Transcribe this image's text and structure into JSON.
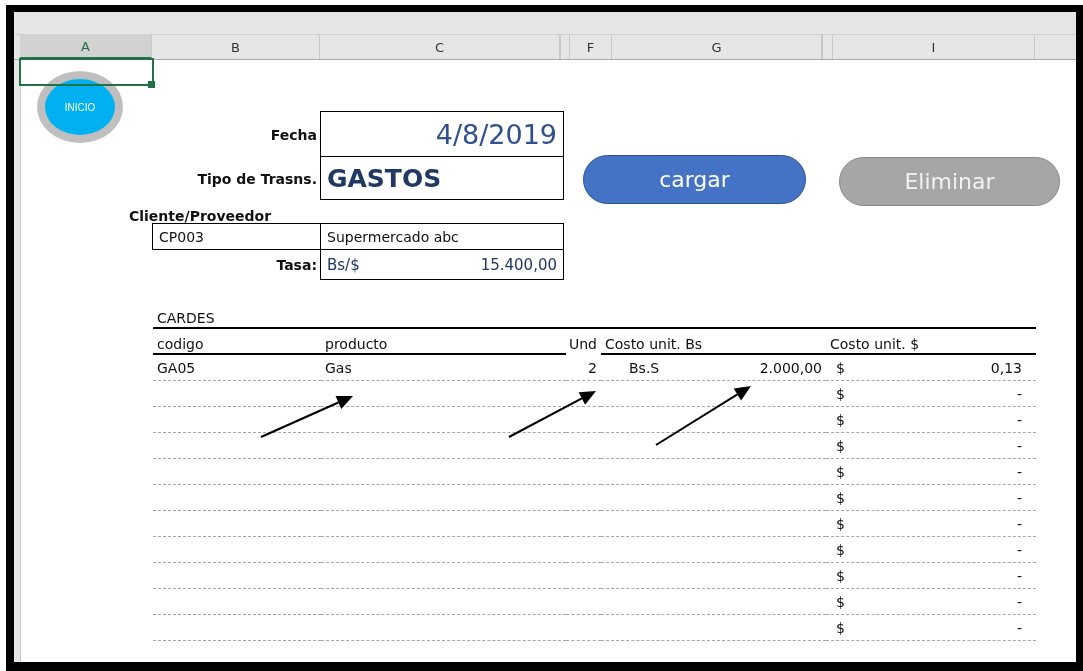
{
  "column_headers": [
    {
      "label": "A",
      "selected": true
    },
    {
      "label": "B",
      "selected": false
    },
    {
      "label": "C",
      "selected": false
    },
    {
      "label": "F",
      "selected": false
    },
    {
      "label": "G",
      "selected": false
    },
    {
      "label": "I",
      "selected": false
    }
  ],
  "inicio_button": {
    "label": "INICIO"
  },
  "form": {
    "fecha": {
      "label": "Fecha",
      "value": "4/8/2019"
    },
    "tipo": {
      "label": "Tipo de Trasns.",
      "value": "GASTOS"
    },
    "cliente": {
      "label": "Cliente/Proveedor",
      "code": "CP003",
      "name": "Supermercado abc"
    },
    "tasa": {
      "label": "Tasa:",
      "unit": "Bs/$",
      "value": "15.400,00"
    }
  },
  "buttons": [
    {
      "label": "cargar",
      "kind": "primary"
    },
    {
      "label": "Eliminar",
      "kind": "secondary"
    }
  ],
  "table": {
    "title": "CARDES",
    "columns": [
      "codigo",
      "producto",
      "Und",
      "Costo unit. Bs",
      "Costo unit. $"
    ],
    "rows": [
      {
        "codigo": "GA05",
        "producto": "Gas",
        "und": "2",
        "bs_currency": "Bs.S",
        "bs_value": "2.000,00",
        "usd_currency": "$",
        "usd_value": "0,13"
      },
      {
        "usd_currency": "$",
        "usd_value": "-"
      },
      {
        "usd_currency": "$",
        "usd_value": "-"
      },
      {
        "usd_currency": "$",
        "usd_value": "-"
      },
      {
        "usd_currency": "$",
        "usd_value": "-"
      },
      {
        "usd_currency": "$",
        "usd_value": "-"
      },
      {
        "usd_currency": "$",
        "usd_value": "-"
      },
      {
        "usd_currency": "$",
        "usd_value": "-"
      },
      {
        "usd_currency": "$",
        "usd_value": "-"
      },
      {
        "usd_currency": "$",
        "usd_value": "-"
      },
      {
        "usd_currency": "$",
        "usd_value": "-"
      }
    ]
  }
}
